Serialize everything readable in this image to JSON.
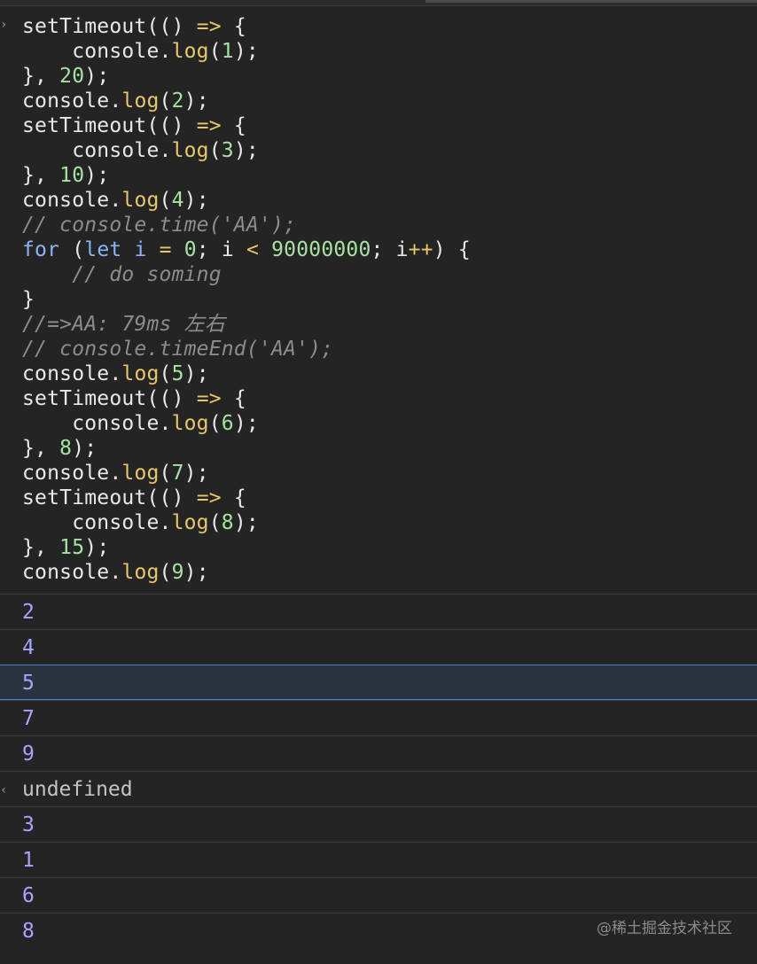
{
  "console": {
    "prompt_icon": "chevron-right-icon",
    "code_lines": [
      [
        {
          "t": "setTimeout",
          "c": "id"
        },
        {
          "t": "(() ",
          "c": "pun"
        },
        {
          "t": "=>",
          "c": "op"
        },
        {
          "t": " {",
          "c": "pun"
        }
      ],
      [
        {
          "t": "    console.",
          "c": "id"
        },
        {
          "t": "log",
          "c": "fn"
        },
        {
          "t": "(",
          "c": "pun"
        },
        {
          "t": "1",
          "c": "num"
        },
        {
          "t": ");",
          "c": "pun"
        }
      ],
      [
        {
          "t": "}, ",
          "c": "pun"
        },
        {
          "t": "20",
          "c": "num"
        },
        {
          "t": ");",
          "c": "pun"
        }
      ],
      [
        {
          "t": "console.",
          "c": "id"
        },
        {
          "t": "log",
          "c": "fn"
        },
        {
          "t": "(",
          "c": "pun"
        },
        {
          "t": "2",
          "c": "num"
        },
        {
          "t": ");",
          "c": "pun"
        }
      ],
      [
        {
          "t": "setTimeout",
          "c": "id"
        },
        {
          "t": "(() ",
          "c": "pun"
        },
        {
          "t": "=>",
          "c": "op"
        },
        {
          "t": " {",
          "c": "pun"
        }
      ],
      [
        {
          "t": "    console.",
          "c": "id"
        },
        {
          "t": "log",
          "c": "fn"
        },
        {
          "t": "(",
          "c": "pun"
        },
        {
          "t": "3",
          "c": "num"
        },
        {
          "t": ");",
          "c": "pun"
        }
      ],
      [
        {
          "t": "}, ",
          "c": "pun"
        },
        {
          "t": "10",
          "c": "num"
        },
        {
          "t": ");",
          "c": "pun"
        }
      ],
      [
        {
          "t": "console.",
          "c": "id"
        },
        {
          "t": "log",
          "c": "fn"
        },
        {
          "t": "(",
          "c": "pun"
        },
        {
          "t": "4",
          "c": "num"
        },
        {
          "t": ");",
          "c": "pun"
        }
      ],
      [
        {
          "t": "// console.time('AA');",
          "c": "cm"
        }
      ],
      [
        {
          "t": "for",
          "c": "kw"
        },
        {
          "t": " (",
          "c": "pun"
        },
        {
          "t": "let",
          "c": "kw"
        },
        {
          "t": " ",
          "c": "pun"
        },
        {
          "t": "i",
          "c": "var"
        },
        {
          "t": " ",
          "c": "pun"
        },
        {
          "t": "=",
          "c": "op"
        },
        {
          "t": " ",
          "c": "pun"
        },
        {
          "t": "0",
          "c": "num"
        },
        {
          "t": "; i ",
          "c": "pun"
        },
        {
          "t": "<",
          "c": "op"
        },
        {
          "t": " ",
          "c": "pun"
        },
        {
          "t": "90000000",
          "c": "num"
        },
        {
          "t": "; i",
          "c": "pun"
        },
        {
          "t": "++",
          "c": "op"
        },
        {
          "t": ") {",
          "c": "pun"
        }
      ],
      [
        {
          "t": "    // do soming",
          "c": "cm"
        }
      ],
      [
        {
          "t": "}",
          "c": "pun"
        }
      ],
      [
        {
          "t": "//=>AA: 79ms 左右",
          "c": "cm"
        }
      ],
      [
        {
          "t": "// console.timeEnd('AA');",
          "c": "cm"
        }
      ],
      [
        {
          "t": "console.",
          "c": "id"
        },
        {
          "t": "log",
          "c": "fn"
        },
        {
          "t": "(",
          "c": "pun"
        },
        {
          "t": "5",
          "c": "num"
        },
        {
          "t": ");",
          "c": "pun"
        }
      ],
      [
        {
          "t": "setTimeout",
          "c": "id"
        },
        {
          "t": "(() ",
          "c": "pun"
        },
        {
          "t": "=>",
          "c": "op"
        },
        {
          "t": " {",
          "c": "pun"
        }
      ],
      [
        {
          "t": "    console.",
          "c": "id"
        },
        {
          "t": "log",
          "c": "fn"
        },
        {
          "t": "(",
          "c": "pun"
        },
        {
          "t": "6",
          "c": "num"
        },
        {
          "t": ");",
          "c": "pun"
        }
      ],
      [
        {
          "t": "}, ",
          "c": "pun"
        },
        {
          "t": "8",
          "c": "num"
        },
        {
          "t": ");",
          "c": "pun"
        }
      ],
      [
        {
          "t": "console.",
          "c": "id"
        },
        {
          "t": "log",
          "c": "fn"
        },
        {
          "t": "(",
          "c": "pun"
        },
        {
          "t": "7",
          "c": "num"
        },
        {
          "t": ");",
          "c": "pun"
        }
      ],
      [
        {
          "t": "setTimeout",
          "c": "id"
        },
        {
          "t": "(() ",
          "c": "pun"
        },
        {
          "t": "=>",
          "c": "op"
        },
        {
          "t": " {",
          "c": "pun"
        }
      ],
      [
        {
          "t": "    console.",
          "c": "id"
        },
        {
          "t": "log",
          "c": "fn"
        },
        {
          "t": "(",
          "c": "pun"
        },
        {
          "t": "8",
          "c": "num"
        },
        {
          "t": ");",
          "c": "pun"
        }
      ],
      [
        {
          "t": "}, ",
          "c": "pun"
        },
        {
          "t": "15",
          "c": "num"
        },
        {
          "t": ");",
          "c": "pun"
        }
      ],
      [
        {
          "t": "console.",
          "c": "id"
        },
        {
          "t": "log",
          "c": "fn"
        },
        {
          "t": "(",
          "c": "pun"
        },
        {
          "t": "9",
          "c": "num"
        },
        {
          "t": ");",
          "c": "pun"
        }
      ]
    ],
    "outputs": [
      {
        "text": "2",
        "kind": "log",
        "selected": false
      },
      {
        "text": "4",
        "kind": "log",
        "selected": false
      },
      {
        "text": "5",
        "kind": "log",
        "selected": true
      },
      {
        "text": "7",
        "kind": "log",
        "selected": false
      },
      {
        "text": "9",
        "kind": "log",
        "selected": false
      },
      {
        "text": "undefined",
        "kind": "result",
        "selected": false
      },
      {
        "text": "3",
        "kind": "log",
        "selected": false
      },
      {
        "text": "1",
        "kind": "log",
        "selected": false
      },
      {
        "text": "6",
        "kind": "log",
        "selected": false
      },
      {
        "text": "8",
        "kind": "log",
        "selected": false
      }
    ],
    "result_icon": "return-value-chevron-icon"
  },
  "watermark": "@稀土掘金技术社区",
  "colors": {
    "background": "#242424",
    "log_value": "#a8a4ff",
    "selection_border": "#4d7ec8"
  }
}
